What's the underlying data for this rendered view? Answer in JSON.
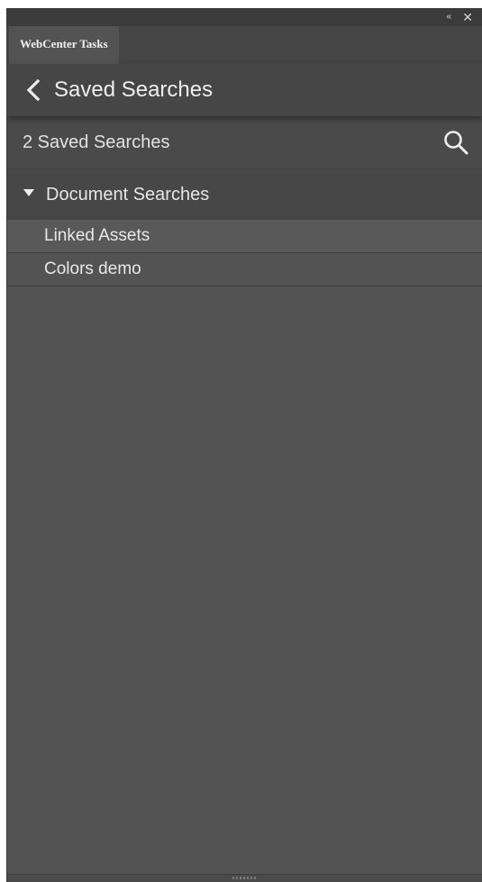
{
  "window": {
    "collapse_glyph": "«",
    "close_glyph": "✕"
  },
  "tabs": [
    {
      "label": "WebCenter Tasks"
    }
  ],
  "header": {
    "title": "Saved Searches",
    "back_icon": "chevron-left-icon"
  },
  "summary": {
    "count_text": "2 Saved Searches",
    "search_icon": "search-icon"
  },
  "groups": [
    {
      "label": "Document Searches",
      "expanded": true,
      "items": [
        {
          "label": "Linked Assets"
        },
        {
          "label": "Colors demo"
        }
      ]
    }
  ],
  "colors": {
    "panel_bg": "#535353",
    "header_bg": "#464646",
    "text": "#e8e8e8"
  }
}
